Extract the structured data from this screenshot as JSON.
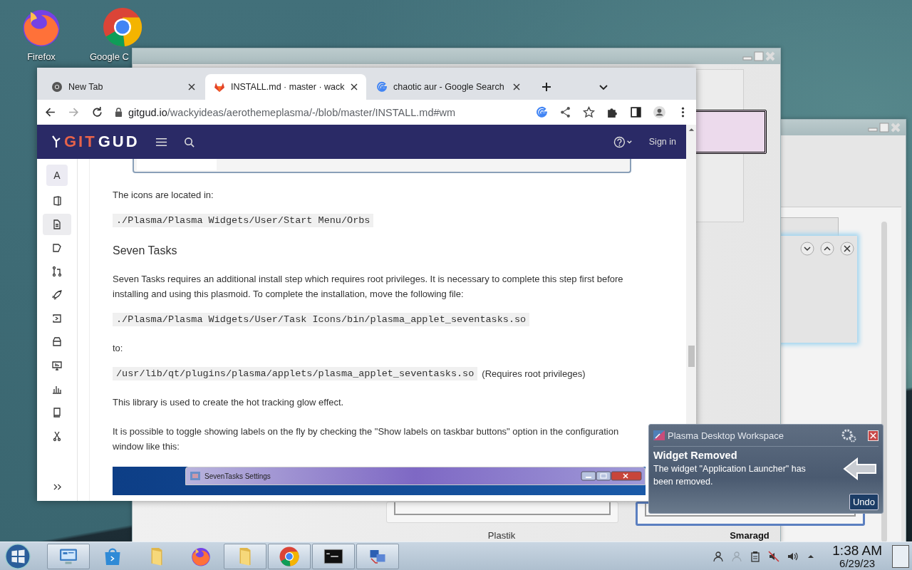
{
  "desktop_icons": [
    {
      "kind": "firefox",
      "label": "Firefox"
    },
    {
      "kind": "chrome",
      "label": "Google C"
    }
  ],
  "background_windows": {
    "captions": [
      {
        "label": "Plastik",
        "selected": false
      },
      {
        "label": "Smaragd",
        "selected": true
      }
    ]
  },
  "browser": {
    "tabs": [
      {
        "kind": "chrome",
        "title": "New Tab",
        "selected": false
      },
      {
        "kind": "gitlab",
        "title": "INSTALL.md · master · wack",
        "selected": true
      },
      {
        "kind": "google",
        "title": "chaotic aur - Google Search",
        "selected": false
      }
    ],
    "url_host": "gitgud.io",
    "url_path": "/wackyideas/aerothemeplasma/-/blob/master/INSTALL.md#wm",
    "header": {
      "logo": "GITGUD",
      "sign_in": "Sign in"
    },
    "sidebar": {
      "avatar": "A",
      "items": [
        {
          "kind": "project",
          "selected": false
        },
        {
          "kind": "file",
          "selected": true
        },
        {
          "kind": "issue",
          "selected": false
        },
        {
          "kind": "merge",
          "selected": false
        },
        {
          "kind": "rocket",
          "selected": false
        },
        {
          "kind": "deploy",
          "selected": false
        },
        {
          "kind": "package",
          "selected": false
        },
        {
          "kind": "monitor",
          "selected": false
        },
        {
          "kind": "analytics",
          "selected": false
        },
        {
          "kind": "wiki",
          "selected": false
        },
        {
          "kind": "snippet",
          "selected": false
        }
      ]
    },
    "content": [
      {
        "kind": "paragraph",
        "text": "The icons are located in:"
      },
      {
        "kind": "code",
        "text": "./Plasma/Plasma Widgets/User/Start Menu/Orbs"
      },
      {
        "kind": "heading",
        "text": "Seven Tasks"
      },
      {
        "kind": "paragraph",
        "text": "Seven Tasks requires an additional install step which requires root privileges. It is necessary to complete this step first before installing and using this plasmoid. To complete the installation, move the following file:"
      },
      {
        "kind": "code",
        "text": "./Plasma/Plasma Widgets/User/Task Icons/bin/plasma_applet_seventasks.so"
      },
      {
        "kind": "paragraph",
        "text": "to:"
      },
      {
        "kind": "code",
        "text": "/usr/lib/qt/plugins/plasma/applets/plasma_applet_seventasks.so",
        "note": "(Requires root privileges)"
      },
      {
        "kind": "paragraph",
        "text": "This library is used to create the hot tracking glow effect."
      },
      {
        "kind": "paragraph",
        "text": "It is possible to toggle showing labels on the fly by checking the \"Show labels on taskbar buttons\" option in the configuration window like this:"
      },
      {
        "kind": "screenshot",
        "window_title": "SevenTasks Settings"
      }
    ]
  },
  "notification": {
    "app": "Plasma Desktop Workspace",
    "title": "Widget Removed",
    "body": "The widget \"Application Launcher\" has been removed.",
    "button": "Undo"
  },
  "taskbar": {
    "items": [
      {
        "kind": "control-panel",
        "open": true
      },
      {
        "kind": "store",
        "open": false
      },
      {
        "kind": "folder",
        "open": false
      },
      {
        "kind": "firefox",
        "open": false
      },
      {
        "kind": "folder",
        "open": true
      },
      {
        "kind": "chrome",
        "open": true
      },
      {
        "kind": "terminal",
        "open": true
      },
      {
        "kind": "network",
        "open": true
      }
    ],
    "tray": [
      {
        "kind": "user",
        "disabled": false
      },
      {
        "kind": "user",
        "disabled": true
      },
      {
        "kind": "clipboard",
        "disabled": false
      },
      {
        "kind": "muted",
        "disabled": false
      },
      {
        "kind": "volume",
        "disabled": false
      },
      {
        "kind": "expand",
        "disabled": false
      }
    ],
    "time": "1:38 AM",
    "date": "6/29/23"
  }
}
